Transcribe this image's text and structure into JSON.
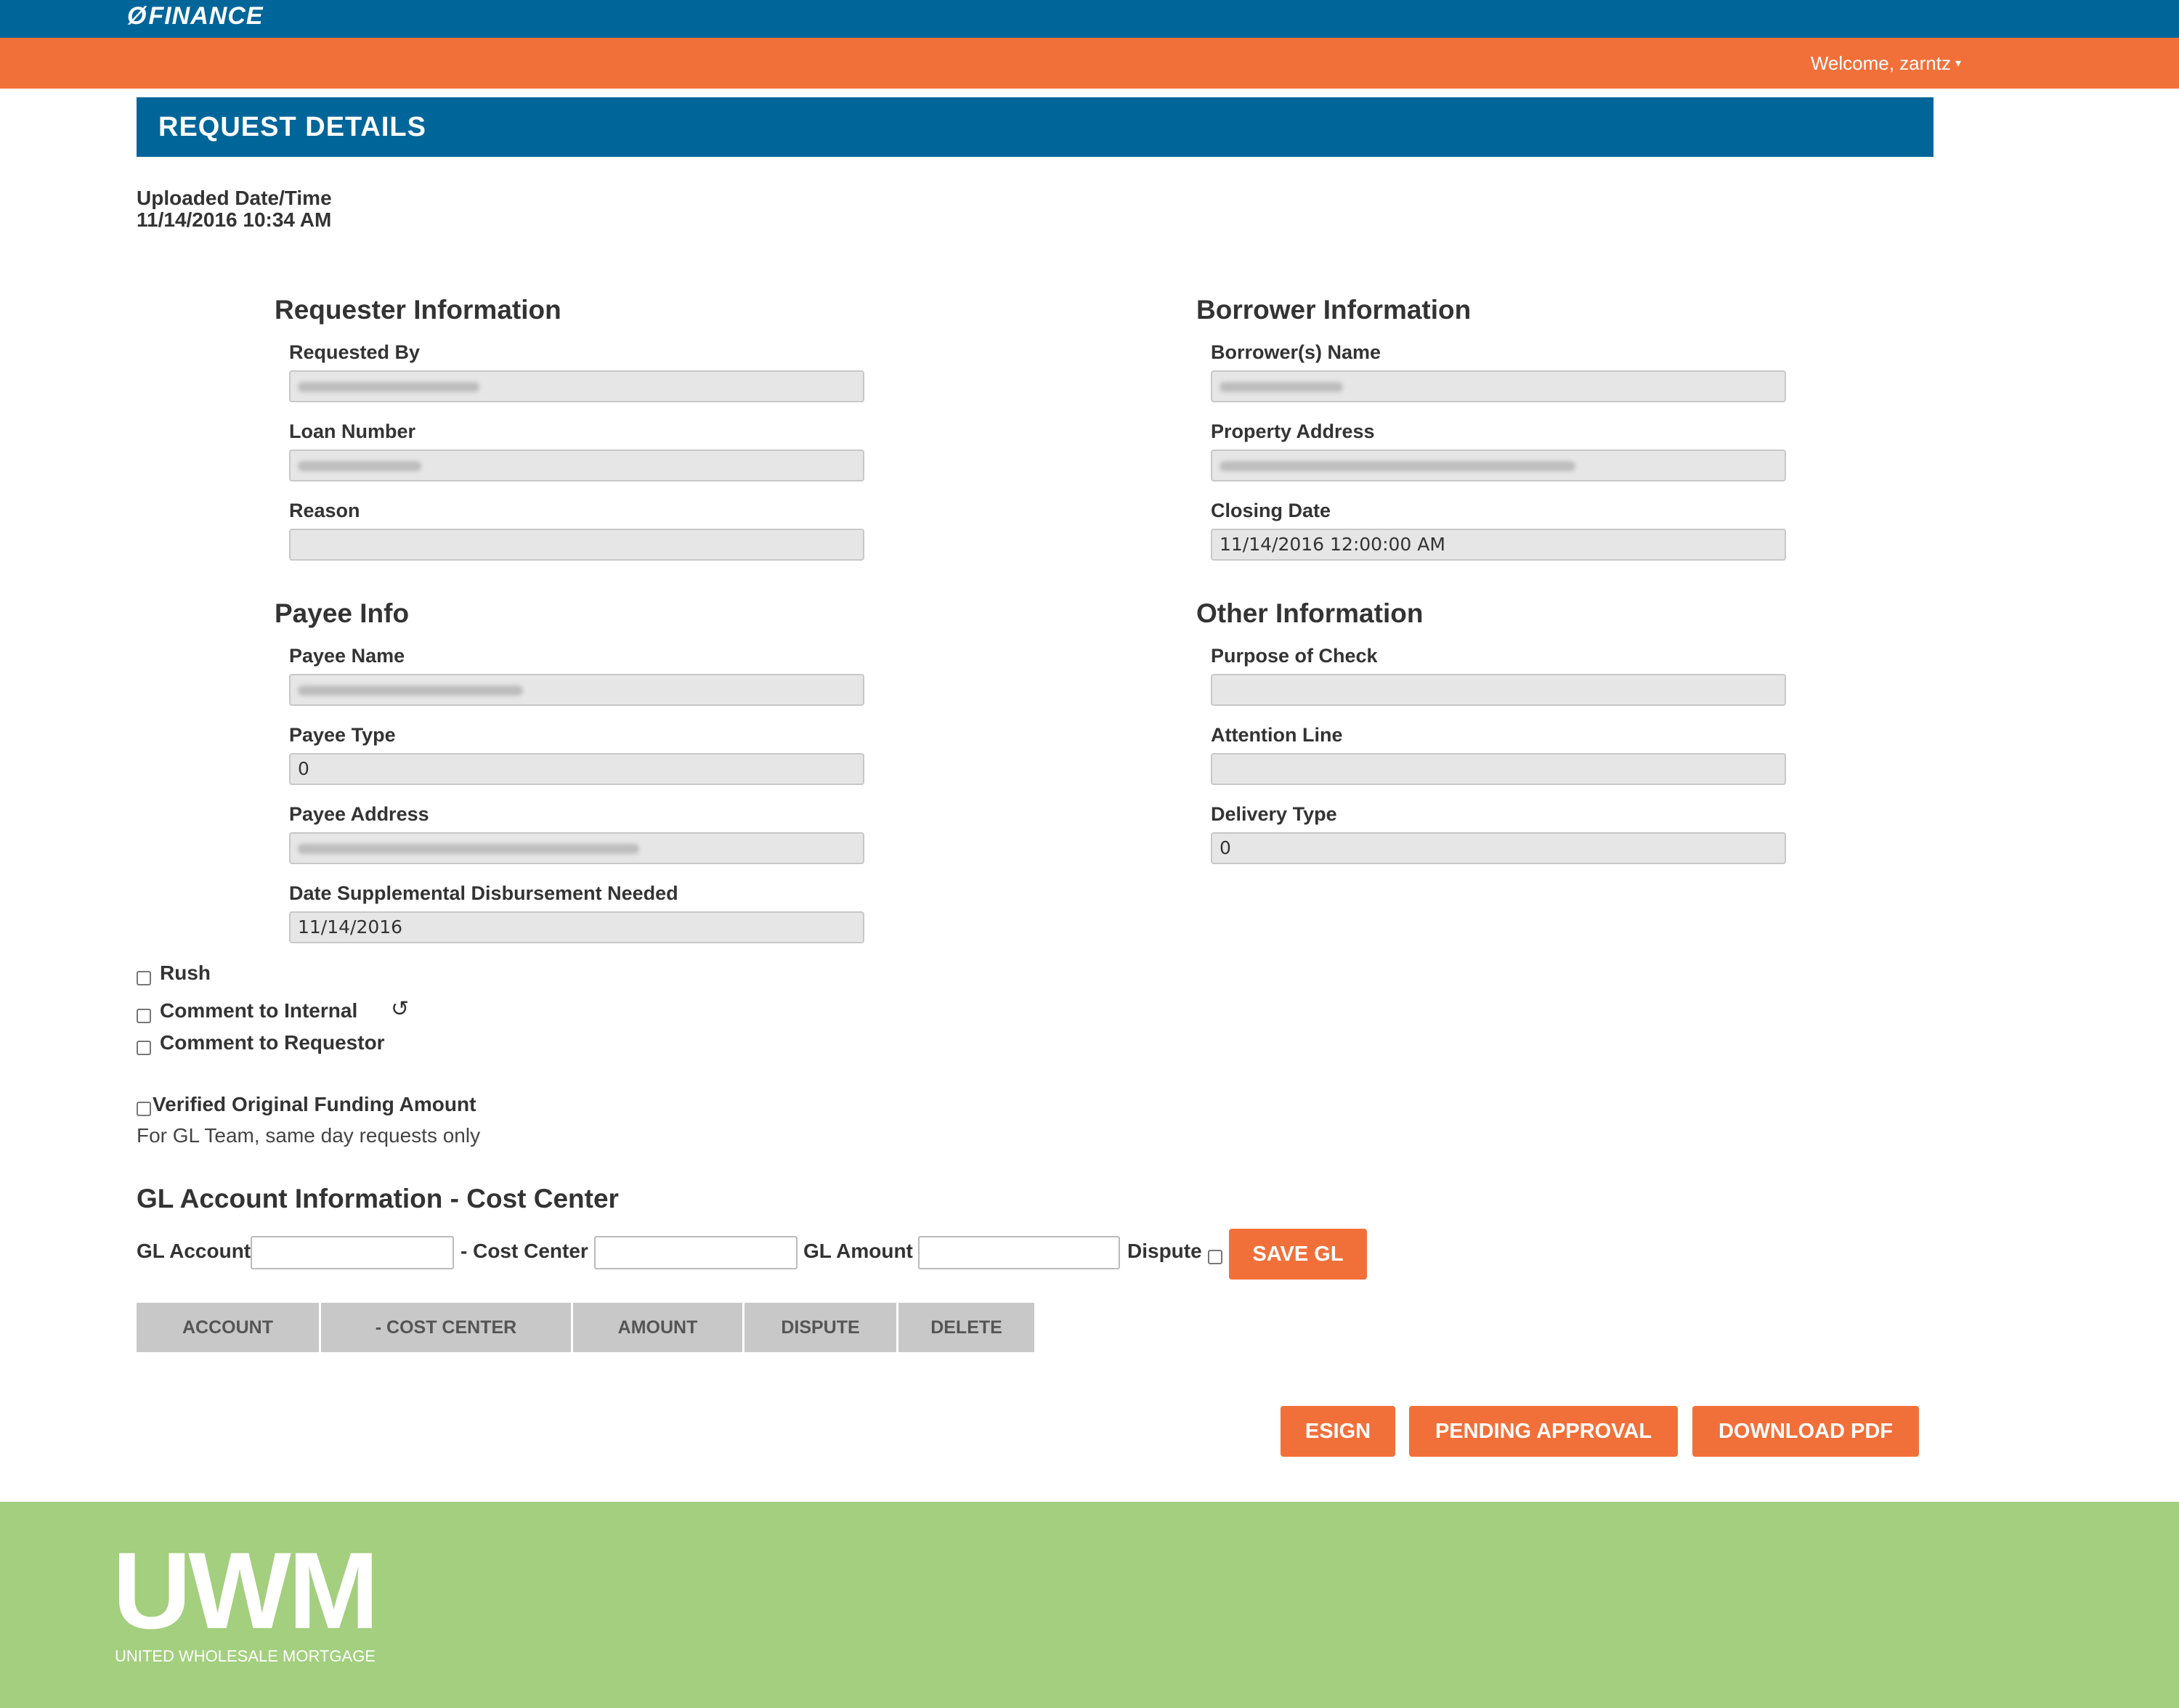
{
  "header": {
    "brand": "FINANCE",
    "welcome": "Welcome, zarntz",
    "caret": "▾"
  },
  "page": {
    "title": "REQUEST DETAILS",
    "uploaded_label": "Uploaded Date/Time",
    "uploaded_value": "11/14/2016 10:34 AM"
  },
  "requester": {
    "title": "Requester Information",
    "requested_by_label": "Requested By",
    "loan_number_label": "Loan Number",
    "reason_label": "Reason",
    "reason_value": ""
  },
  "borrower": {
    "title": "Borrower Information",
    "name_label": "Borrower(s) Name",
    "property_label": "Property Address",
    "closing_label": "Closing Date",
    "closing_value": "11/14/2016 12:00:00 AM"
  },
  "payee": {
    "title": "Payee Info",
    "name_label": "Payee Name",
    "type_label": "Payee Type",
    "type_value": "0",
    "address_label": "Payee Address",
    "date_label": "Date Supplemental Disbursement Needed",
    "date_value": "11/14/2016"
  },
  "other": {
    "title": "Other Information",
    "purpose_label": "Purpose of Check",
    "purpose_value": "",
    "attention_label": "Attention Line",
    "attention_value": "",
    "delivery_label": "Delivery Type",
    "delivery_value": "0"
  },
  "options": {
    "rush": "Rush",
    "comment_internal": "Comment to Internal",
    "comment_requestor": "Comment to Requestor",
    "verified": "Verified Original Funding Amount",
    "verified_note": "For GL Team, same day requests only",
    "history_icon": "↺"
  },
  "gl": {
    "title": "GL Account Information - Cost Center",
    "account_label": "GL Account",
    "cost_center_label": "- Cost Center",
    "amount_label": "GL Amount",
    "dispute_label": "Dispute",
    "save_button": "SAVE GL",
    "columns": [
      "ACCOUNT",
      "- COST CENTER",
      "AMOUNT",
      "DISPUTE",
      "DELETE"
    ]
  },
  "actions": {
    "esign": "ESIGN",
    "pending": "PENDING APPROVAL",
    "download": "DOWNLOAD PDF"
  },
  "footer": {
    "logo": "UWM",
    "logo_sub": "UNITED WHOLESALE MORTGAGE"
  },
  "colors": {
    "blue": "#006699",
    "orange": "#f1703a",
    "green": "#a3cf7e"
  }
}
